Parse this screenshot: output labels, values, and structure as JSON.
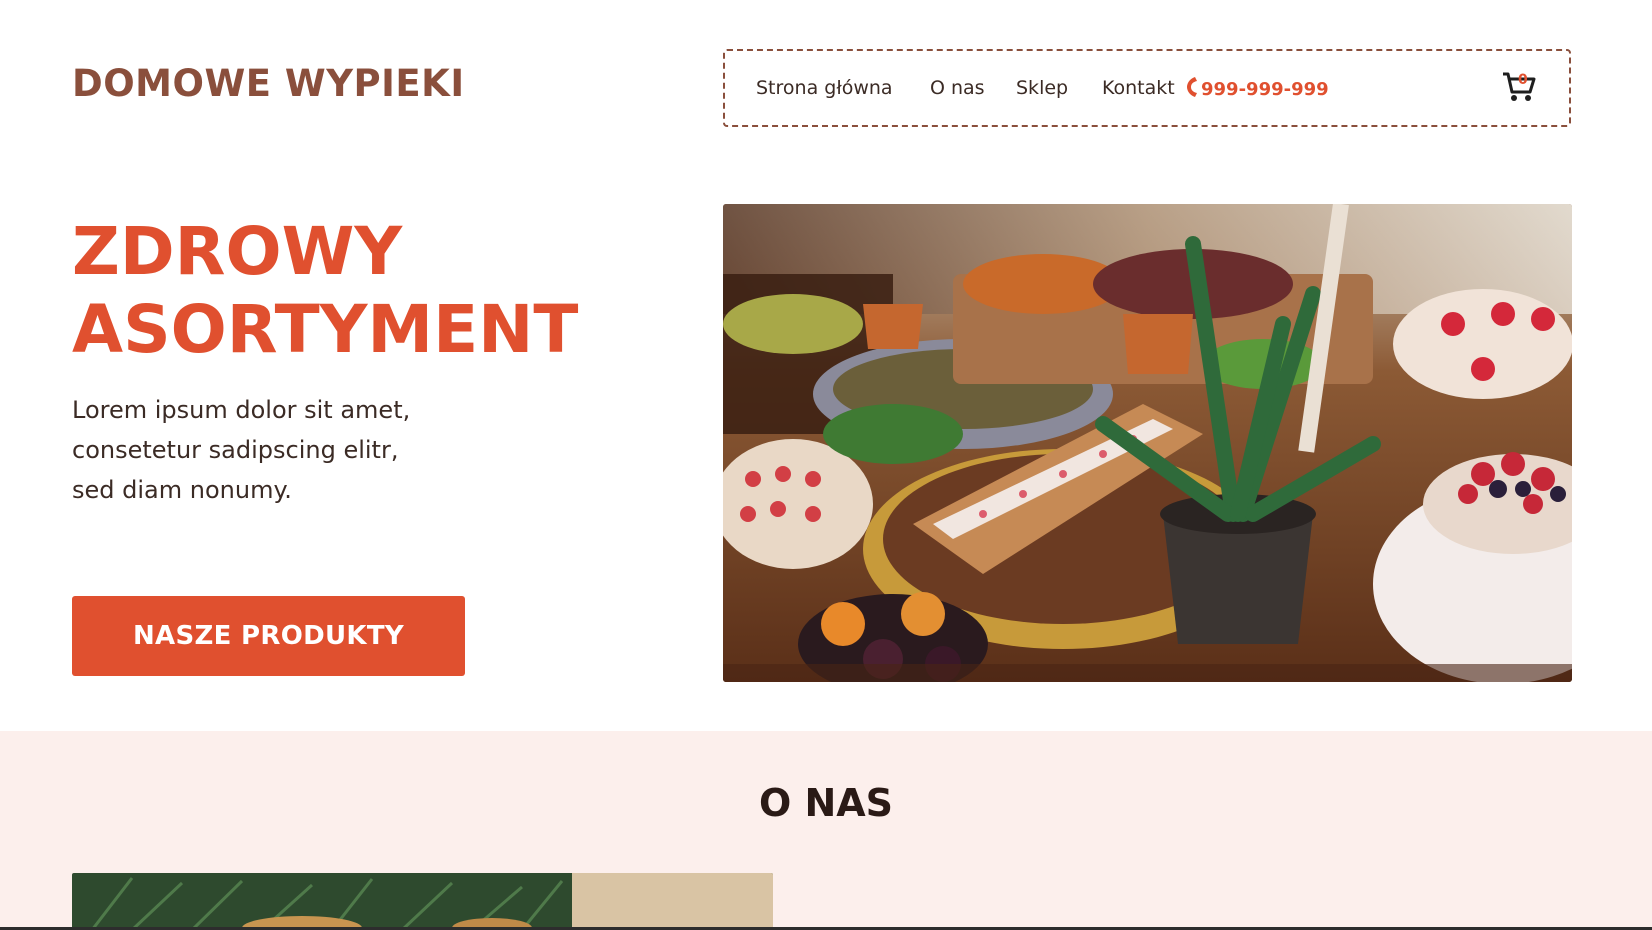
{
  "header": {
    "brand": "DOMOWE WYPIEKI",
    "nav": {
      "links": [
        {
          "label": "Strona główna"
        },
        {
          "label": "O nas"
        },
        {
          "label": "Sklep"
        },
        {
          "label": "Kontakt"
        }
      ],
      "phone": "999-999-999",
      "phone_icon": "phone-icon",
      "cart_icon": "cart-icon",
      "cart_count": "0"
    }
  },
  "hero": {
    "title_line1": "ZDROWY",
    "title_line2": "ASORTYMENT",
    "text_line1": "Lorem ipsum dolor sit amet,",
    "text_line2": "consetetur sadipscing elitr,",
    "text_line3": "sed diam nonumy.",
    "cta_label": "NASZE PRODUKTY",
    "image_alt": "hero-pastry-table-photo"
  },
  "about": {
    "title": "O NAS"
  },
  "colors": {
    "accent": "#e0502f",
    "brand": "#8a4f3c",
    "about_bg": "#fcefec"
  }
}
